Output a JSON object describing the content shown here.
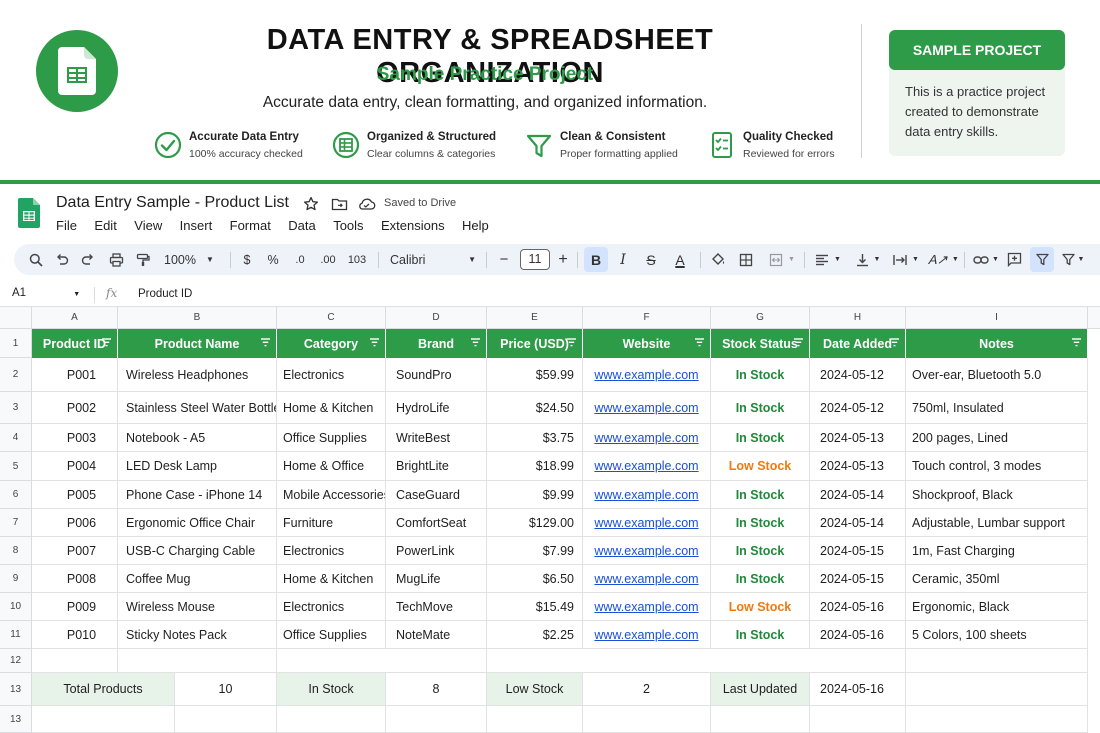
{
  "banner": {
    "title": "DATA ENTRY & SPREADSHEET ORGANIZATION",
    "subtitle": "Sample Practice Project",
    "description": "Accurate data entry, clean formatting, and organized information.",
    "features": [
      {
        "title": "Accurate Data Entry",
        "sub": "100% accuracy checked",
        "icon": "check-circle-icon"
      },
      {
        "title": "Organized & Structured",
        "sub": "Clear columns & categories",
        "icon": "table-icon"
      },
      {
        "title": "Clean & Consistent",
        "sub": "Proper formatting applied",
        "icon": "funnel-icon"
      },
      {
        "title": "Quality Checked",
        "sub": "Reviewed for errors",
        "icon": "checklist-icon"
      }
    ],
    "card": {
      "heading": "SAMPLE PROJECT",
      "text": "This is a practice project created to demonstrate data entry skills."
    },
    "accent": "#2e9b48"
  },
  "sheet": {
    "doc_title": "Data Entry Sample - Product List",
    "saved_status": "Saved to Drive",
    "menu": [
      "File",
      "Edit",
      "View",
      "Insert",
      "Format",
      "Data",
      "Tools",
      "Extensions",
      "Help"
    ],
    "toolbar": {
      "zoom": "100%",
      "currency": "$",
      "percent": "%",
      "dec_less": ".0",
      "dec_more": ".00",
      "format_num": "103",
      "font": "Calibri",
      "font_size": "11",
      "minus": "−",
      "plus": "+",
      "bold": "B",
      "italic": "I",
      "strike": "S",
      "text_color": "A"
    },
    "name_box": "A1",
    "fx": "fx",
    "formula": "Product ID"
  },
  "grid": {
    "col_letters": [
      "A",
      "B",
      "C",
      "D",
      "E",
      "F",
      "G",
      "H",
      "I"
    ],
    "headers": [
      "Product ID",
      "Product Name",
      "Category",
      "Brand",
      "Price (USD)",
      "Website",
      "Stock Status",
      "Date Added",
      "Notes"
    ],
    "rows": [
      {
        "num": "2",
        "id": "P001",
        "name": "Wireless Headphones",
        "category": "Electronics",
        "brand": "SoundPro",
        "price": "$59.99",
        "website": "www.example.com",
        "stock": "In Stock",
        "date": "2024-05-12",
        "notes": "Over-ear, Bluetooth 5.0"
      },
      {
        "num": "3",
        "id": "P002",
        "name": "Stainless Steel Water Bottle",
        "category": "Home & Kitchen",
        "brand": "HydroLife",
        "price": "$24.50",
        "website": "www.example.com",
        "stock": "In Stock",
        "date": "2024-05-12",
        "notes": "750ml, Insulated"
      },
      {
        "num": "4",
        "id": "P003",
        "name": "Notebook - A5",
        "category": "Office Supplies",
        "brand": "WriteBest",
        "price": "$3.75",
        "website": "www.example.com",
        "stock": "In Stock",
        "date": "2024-05-13",
        "notes": "200 pages, Lined"
      },
      {
        "num": "5",
        "id": "P004",
        "name": "LED Desk Lamp",
        "category": "Home & Office",
        "brand": "BrightLite",
        "price": "$18.99",
        "website": "www.example.com",
        "stock": "Low Stock",
        "date": "2024-05-13",
        "notes": "Touch control, 3 modes"
      },
      {
        "num": "6",
        "id": "P005",
        "name": "Phone Case - iPhone 14",
        "category": "Mobile Accessories",
        "brand": "CaseGuard",
        "price": "$9.99",
        "website": "www.example.com",
        "stock": "In Stock",
        "date": "2024-05-14",
        "notes": "Shockproof, Black"
      },
      {
        "num": "7",
        "id": "P006",
        "name": "Ergonomic Office Chair",
        "category": "Furniture",
        "brand": "ComfortSeat",
        "price": "$129.00",
        "website": "www.example.com",
        "stock": "In Stock",
        "date": "2024-05-14",
        "notes": "Adjustable, Lumbar support"
      },
      {
        "num": "8",
        "id": "P007",
        "name": "USB-C Charging Cable",
        "category": "Electronics",
        "brand": "PowerLink",
        "price": "$7.99",
        "website": "www.example.com",
        "stock": "In Stock",
        "date": "2024-05-15",
        "notes": "1m, Fast Charging"
      },
      {
        "num": "9",
        "id": "P008",
        "name": "Coffee Mug",
        "category": "Home & Kitchen",
        "brand": "MugLife",
        "price": "$6.50",
        "website": "www.example.com",
        "stock": "In Stock",
        "date": "2024-05-15",
        "notes": "Ceramic, 350ml"
      },
      {
        "num": "10",
        "id": "P009",
        "name": "Wireless Mouse",
        "category": "Electronics",
        "brand": "TechMove",
        "price": "$15.49",
        "website": "www.example.com",
        "stock": "Low Stock",
        "date": "2024-05-16",
        "notes": "Ergonomic, Black"
      },
      {
        "num": "11",
        "id": "P010",
        "name": "Sticky Notes Pack",
        "category": "Office Supplies",
        "brand": "NoteMate",
        "price": "$2.25",
        "website": "www.example.com",
        "stock": "In Stock",
        "date": "2024-05-16",
        "notes": "5 Colors, 100 sheets"
      }
    ],
    "empty_row_num": "12",
    "summary_row_num": "13",
    "last_row_num": "13",
    "summary": {
      "total_label": "Total Products",
      "total_value": "10",
      "in_stock_label": "In Stock",
      "in_stock_value": "8",
      "low_stock_label": "Low Stock",
      "low_stock_value": "2",
      "updated_label": "Last Updated",
      "updated_value": "2024-05-16"
    },
    "colors": {
      "in_stock": "#1f8a3a",
      "low_stock": "#ee7a12",
      "link": "#1a4fd6",
      "header": "#2e9b48"
    }
  }
}
